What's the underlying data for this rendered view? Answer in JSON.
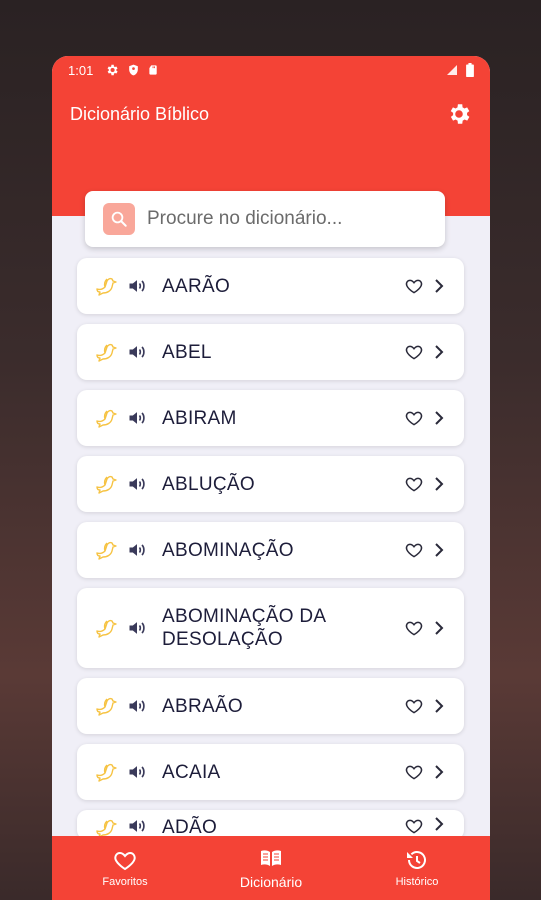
{
  "status": {
    "time": "1:01"
  },
  "app": {
    "title": "Dicionário Bíblico"
  },
  "search": {
    "placeholder": "Procure no dicionário..."
  },
  "words": [
    "AARÃO",
    "ABEL",
    "ABIRAM",
    "ABLUÇÃO",
    "ABOMINAÇÃO",
    "ABOMINAÇÃO DA\nDESOLAÇÃO",
    "ABRAÃO",
    "ACAIA",
    "ADÃO"
  ],
  "nav": [
    {
      "label": "Favoritos",
      "icon": "heart-icon"
    },
    {
      "label": "Dicionário",
      "icon": "book-icon"
    },
    {
      "label": "Histórico",
      "icon": "history-icon"
    }
  ],
  "colors": {
    "primary": "#f44336",
    "background": "#f0eff7",
    "dove": "#f6c343",
    "text": "#1d1d3a"
  }
}
